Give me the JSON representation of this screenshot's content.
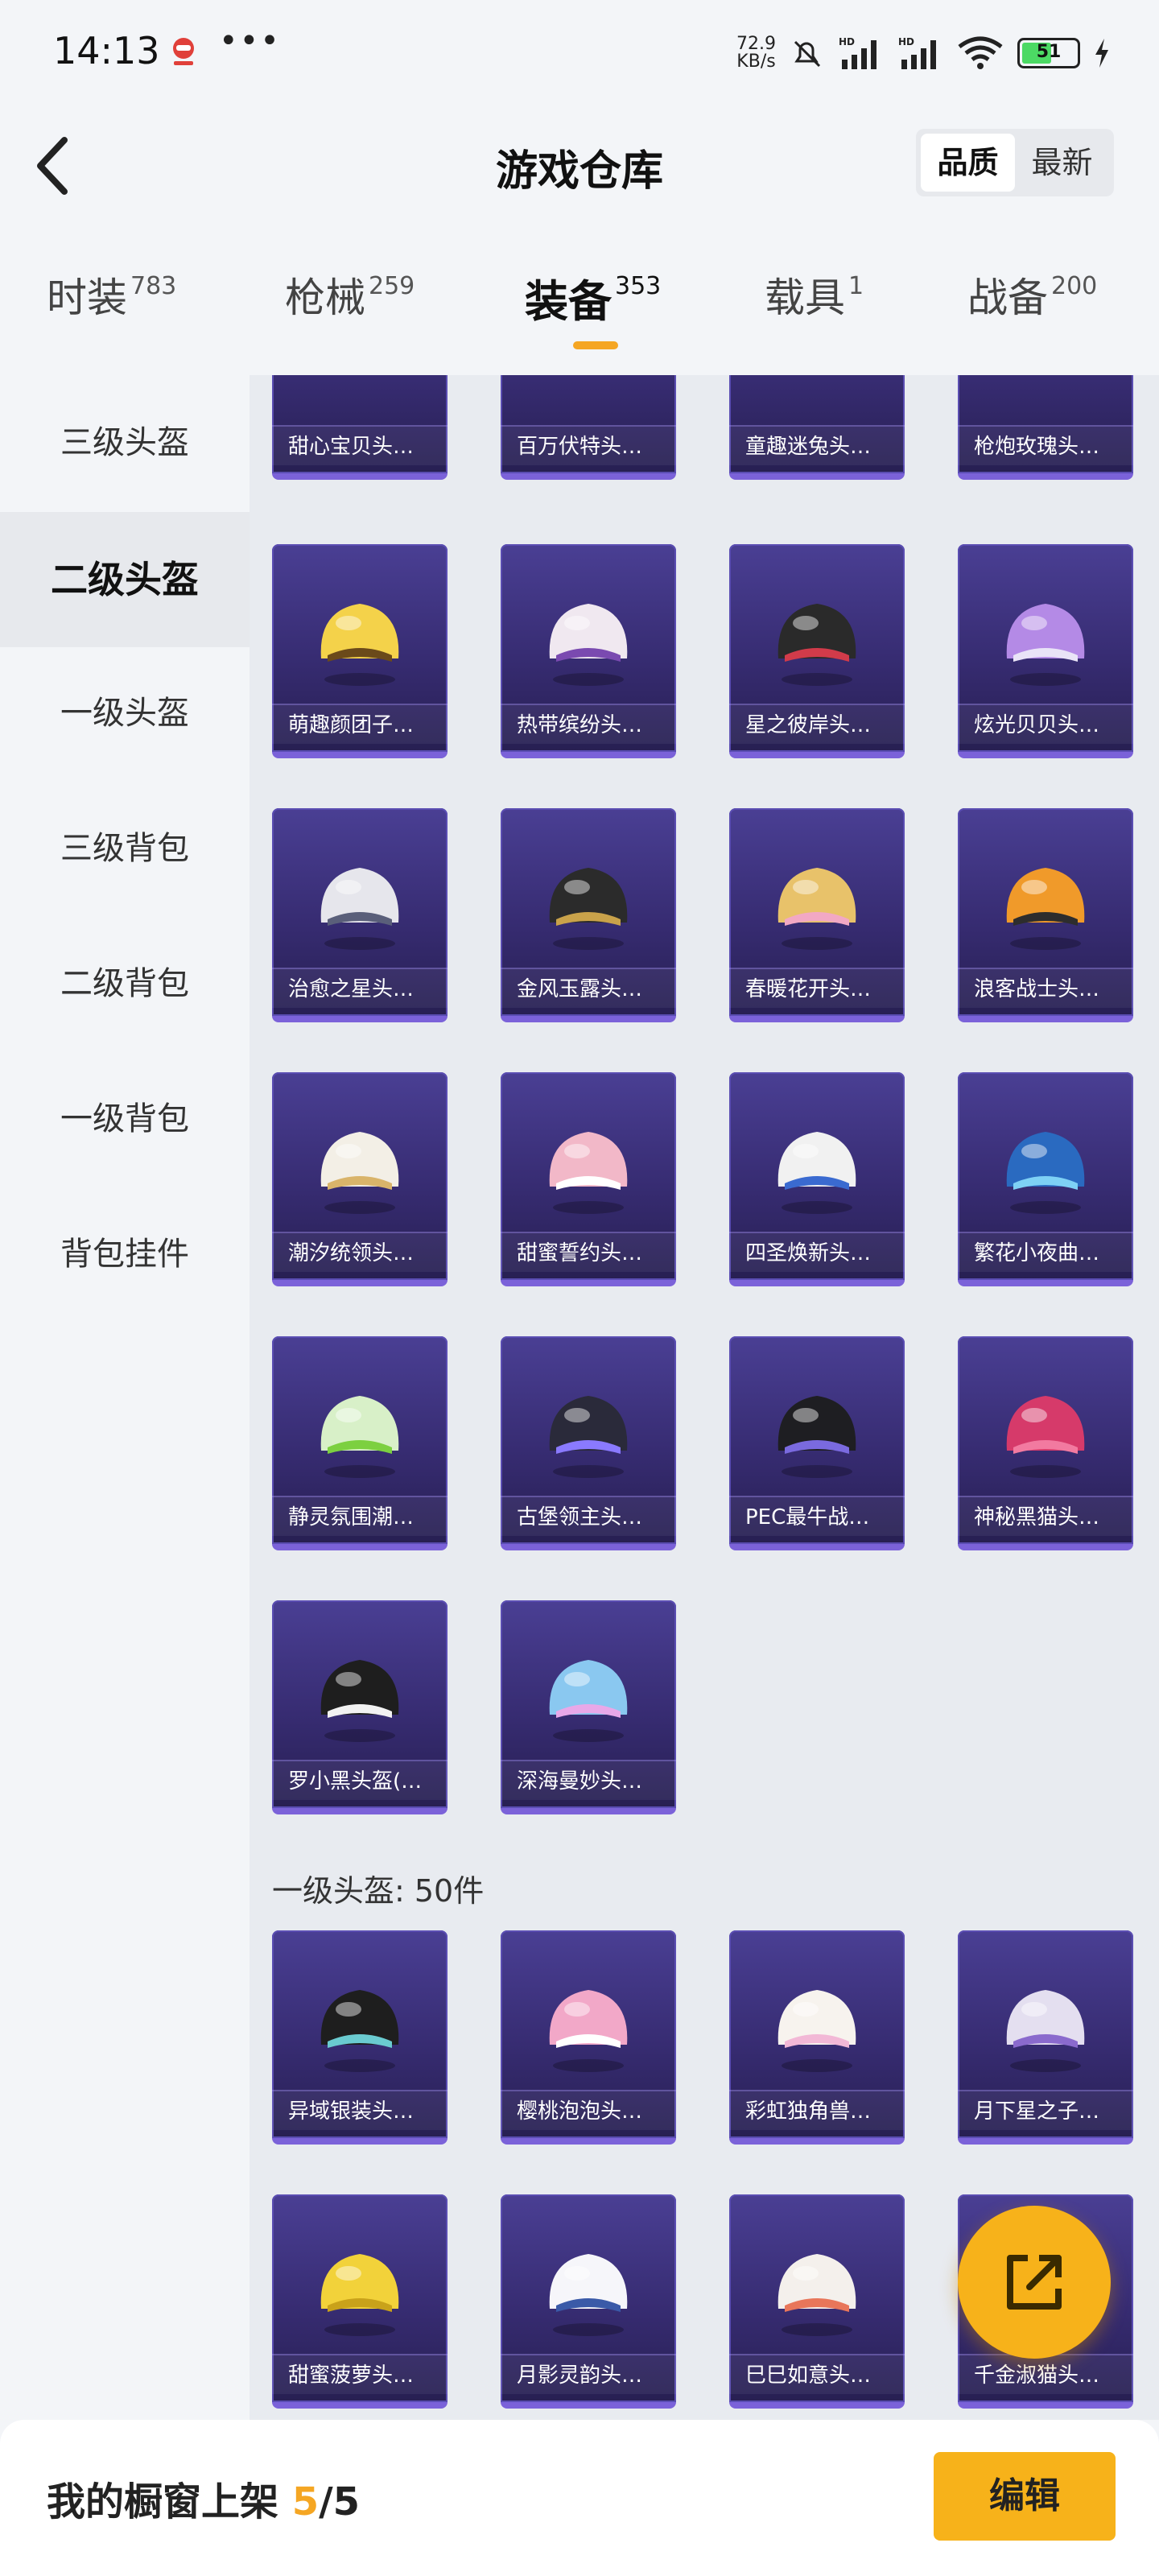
{
  "status_bar": {
    "time": "14:13",
    "dots": "•••",
    "speed_value": "72.9",
    "speed_unit": "KB/s",
    "battery": "51",
    "icons": [
      "app-notification-icon",
      "mute-icon",
      "signal-hd-icon",
      "signal-hd-icon",
      "wifi-icon",
      "battery-icon",
      "charging-icon"
    ]
  },
  "header": {
    "title": "游戏仓库",
    "sort_options": [
      "品质",
      "最新"
    ],
    "active_sort": "品质"
  },
  "tabs": [
    {
      "label": "时装",
      "count": "783"
    },
    {
      "label": "枪械",
      "count": "259"
    },
    {
      "label": "装备",
      "count": "353",
      "active": true
    },
    {
      "label": "载具",
      "count": "1"
    },
    {
      "label": "战备",
      "count": "200"
    }
  ],
  "sidebar": {
    "items": [
      "三级头盔",
      "二级头盔",
      "一级头盔",
      "三级背包",
      "二级背包",
      "一级背包",
      "背包挂件"
    ],
    "active": "二级头盔"
  },
  "grid": {
    "partial_row": [
      "甜心宝贝头…",
      "百万伏特头…",
      "童趣迷兔头…",
      "枪炮玫瑰头…"
    ],
    "level2_items": [
      "萌趣颜团子…",
      "热带缤纷头…",
      "星之彼岸头…",
      "炫光贝贝头…",
      "治愈之星头…",
      "金风玉露头…",
      "春暖花开头…",
      "浪客战士头…",
      "潮汐统领头…",
      "甜蜜誓约头…",
      "四圣焕新头…",
      "繁花小夜曲…",
      "静灵氛围潮…",
      "古堡领主头…",
      "PEC最牛战…",
      "神秘黑猫头…",
      "罗小黑头盔(…",
      "深海曼妙头…"
    ],
    "level1_section_title": "一级头盔: 50件",
    "level1_items": [
      "异域银装头…",
      "樱桃泡泡头…",
      "彩虹独角兽…",
      "月下星之子…",
      "甜蜜菠萝头…",
      "月影灵韵头…",
      "巳巳如意头…",
      "千金淑猫头…"
    ]
  },
  "bottom_bar": {
    "label": "我的橱窗上架 ",
    "count_current": "5",
    "count_total": "/5",
    "edit_label": "编辑"
  },
  "colors": {
    "accent": "#f7b21a",
    "card_top": "#4a3f94",
    "card_bottom": "#271f52",
    "card_border": "#7b62d9"
  }
}
